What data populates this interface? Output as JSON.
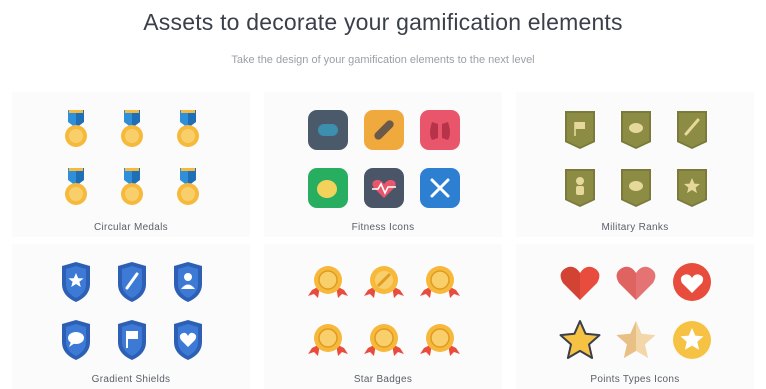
{
  "header": {
    "title": "Assets to decorate your gamification elements",
    "subtitle": "Take the design of your gamification elements to the next level"
  },
  "sections": [
    {
      "label": "Circular Medals",
      "icons": [
        "medal-icon",
        "medal-icon",
        "medal-icon",
        "medal-icon",
        "medal-icon",
        "medal-icon"
      ]
    },
    {
      "label": "Fitness Icons",
      "icons": [
        "pill-icon",
        "bandage-icon",
        "lungs-icon",
        "stomach-icon",
        "heartbeat-icon",
        "cutlery-icon"
      ]
    },
    {
      "label": "Military Ranks",
      "icons": [
        "flag-rank-icon",
        "circle-rank-icon",
        "pen-rank-icon",
        "soldier-rank-icon",
        "circle-rank-icon",
        "star-rank-icon"
      ]
    },
    {
      "label": "Gradient Shields",
      "icons": [
        "star-shield-icon",
        "pen-shield-icon",
        "person-shield-icon",
        "chat-shield-icon",
        "flag-shield-icon",
        "heart-shield-icon"
      ]
    },
    {
      "label": "Star Badges",
      "icons": [
        "badge-icon",
        "pencil-badge-icon",
        "badge-icon",
        "badge-icon",
        "badge-icon",
        "badge-icon"
      ]
    },
    {
      "label": "Points Types Icons",
      "icons": [
        "heart-icon",
        "heart-icon",
        "heart-circle-icon",
        "star-icon",
        "star-icon",
        "star-circle-icon"
      ]
    }
  ],
  "colors": {
    "medal_ribbon": "#2f8fd8",
    "medal_gold": "#f6b93b",
    "fitness_bg": [
      "#4a5a6b",
      "#f0a93c",
      "#e9566b",
      "#27ae60",
      "#4a5568",
      "#2c7fd1"
    ],
    "rank_olive": "#7a7a3a",
    "shield_blue": "#2d5fb5",
    "badge_ribbon": "#e74c3c",
    "heart_red": "#e74c3c",
    "star_gold": "#f6c244"
  }
}
